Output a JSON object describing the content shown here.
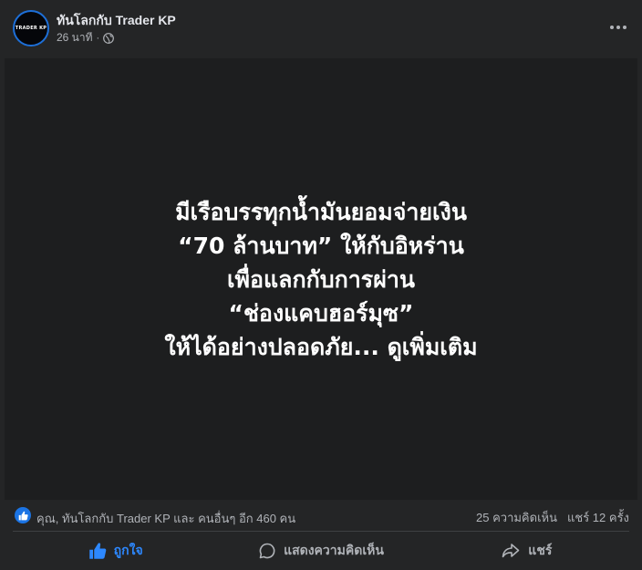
{
  "post": {
    "author": "ทันโลกกับ Trader KP",
    "avatar_text": "TRADER KP",
    "time": "26 นาที",
    "separator": "·",
    "icons": {
      "privacy": "globe-icon",
      "more": "more-options-icon"
    }
  },
  "image": {
    "lines": [
      "มีเรือบรรทุกน้ำมันยอมจ่ายเงิน",
      "“70 ล้านบาท” ให้กับอิหร่าน",
      "เพื่อแลกกับการผ่าน",
      "“ช่องแคบฮอร์มุซ”",
      "ให้ได้อย่างปลอดภัย... ดูเพิ่มเติม"
    ]
  },
  "stats": {
    "reactors": "คุณ, ทันโลกกับ Trader KP และ คนอื่นๆ อีก 460 คน",
    "comments": "25 ความคิดเห็น",
    "shares": "แชร์ 12 ครั้ง"
  },
  "actions": {
    "like": "ถูกใจ",
    "comment": "แสดงความคิดเห็น",
    "share": "แชร์"
  },
  "colors": {
    "background": "#242526",
    "like_blue": "#2d88ff",
    "text_secondary": "#b0b3b8"
  }
}
